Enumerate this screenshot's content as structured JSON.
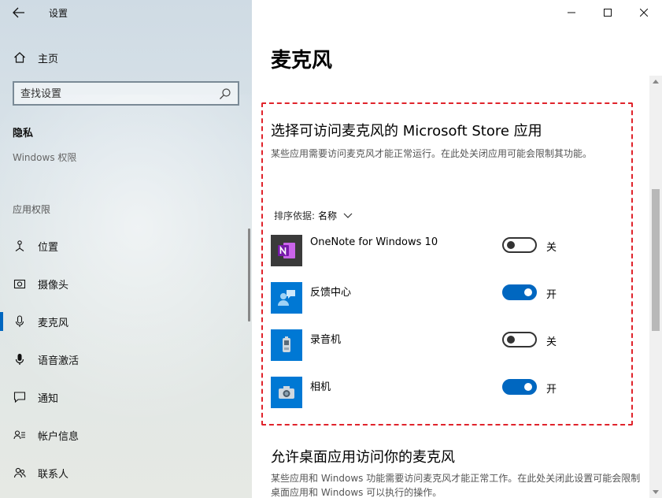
{
  "window": {
    "title": "设置"
  },
  "sidebar": {
    "home_label": "主页",
    "search_placeholder": "查找设置",
    "section_privacy": "隐私",
    "windows_permissions": "Windows 权限",
    "apps_permissions": "应用权限",
    "items": [
      {
        "label": "位置",
        "icon": "location-icon",
        "active": false
      },
      {
        "label": "摄像头",
        "icon": "camera-icon",
        "active": false
      },
      {
        "label": "麦克风",
        "icon": "microphone-icon",
        "active": true
      },
      {
        "label": "语音激活",
        "icon": "voice-activation-icon",
        "active": false
      },
      {
        "label": "通知",
        "icon": "notification-icon",
        "active": false
      },
      {
        "label": "帐户信息",
        "icon": "account-info-icon",
        "active": false
      },
      {
        "label": "联系人",
        "icon": "contacts-icon",
        "active": false
      }
    ]
  },
  "main": {
    "page_title": "麦克风",
    "store_section": {
      "title": "选择可访问麦克风的 Microsoft Store 应用",
      "description": "某些应用需要访问麦克风才能正常运行。在此处关闭应用可能会限制其功能。",
      "sort_label": "排序依据:",
      "sort_value": "名称",
      "apps": [
        {
          "name": "OneNote for Windows 10",
          "state": "关",
          "on": false,
          "tile_color": "#3a3a3a",
          "icon": "onenote-icon"
        },
        {
          "name": "反馈中心",
          "state": "开",
          "on": true,
          "tile_color": "#0078d4",
          "icon": "feedback-hub-icon"
        },
        {
          "name": "录音机",
          "state": "关",
          "on": false,
          "tile_color": "#0078d4",
          "icon": "voice-recorder-icon"
        },
        {
          "name": "相机",
          "state": "开",
          "on": true,
          "tile_color": "#0078d4",
          "icon": "camera-app-icon"
        }
      ]
    },
    "desktop_section": {
      "title": "允许桌面应用访问你的麦克风",
      "description": "某些应用和 Windows 功能需要访问麦克风才能正常工作。在此处关闭此设置可能会限制桌面应用和 Windows 可以执行的操作。"
    }
  },
  "colors": {
    "accent": "#0067c0",
    "highlight_border": "#e0232b"
  }
}
